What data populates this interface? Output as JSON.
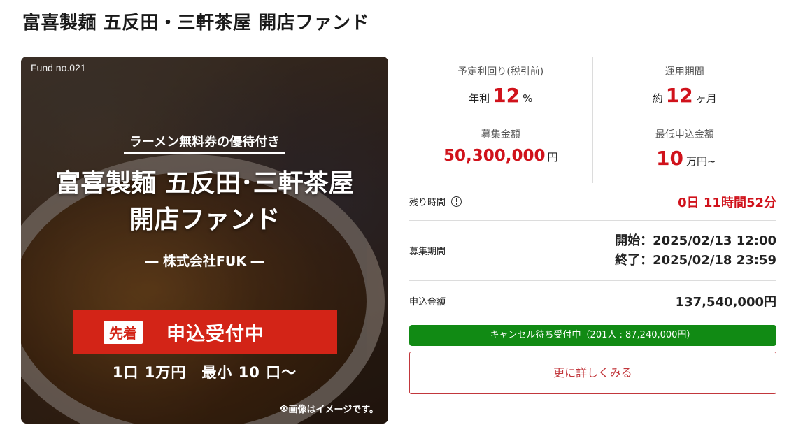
{
  "page": {
    "title": "富喜製麺 五反田・三軒茶屋 開店ファンド"
  },
  "hero": {
    "fund_no": "Fund no.021",
    "badge": "ラーメン無料券の優待付き",
    "title_line1": "富喜製麺 五反田･三軒茶屋",
    "title_line2": "開店ファンド",
    "company": "― 株式会社FUK ―",
    "banner_tag": "先着",
    "banner_status": "申込受付中",
    "unit_text": "1口 1万円　最小 10 口〜",
    "note": "※画像はイメージです。"
  },
  "stats": {
    "yield": {
      "label": "予定利回り(税引前)",
      "prefix": "年利",
      "value": "12",
      "suffix": "%"
    },
    "term": {
      "label": "運用期間",
      "prefix": "約",
      "value": "12",
      "suffix": "ヶ月"
    },
    "target": {
      "label": "募集金額",
      "value": "50,300,000",
      "suffix": "円"
    },
    "minimum": {
      "label": "最低申込金額",
      "value": "10",
      "suffix": "万円~"
    }
  },
  "remaining": {
    "label": "残り時間",
    "value": "0日 11時間52分"
  },
  "period": {
    "label": "募集期間",
    "start": "開始：2025/02/13 12:00",
    "end": "終了：2025/02/18 23:59"
  },
  "applied": {
    "label": "申込金額",
    "value": "137,540,000円"
  },
  "cancel_waitlist": "キャンセル待ち受付中（201人 : 87,240,000円）",
  "more_button": "更に詳しくみる",
  "colors": {
    "accent_red": "#d0121b",
    "banner_red": "#d32417",
    "waitlist_green": "#118a14"
  },
  "icons": {
    "remaining_info": "clock-icon"
  }
}
